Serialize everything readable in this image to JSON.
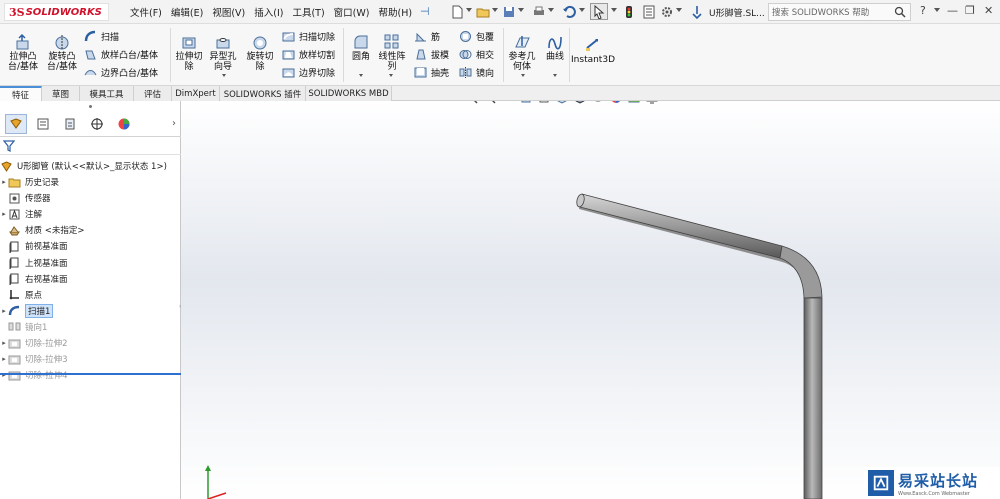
{
  "app": {
    "name": "SOLIDWORKS",
    "brand_color": "#d0112b"
  },
  "menu": [
    "文件(F)",
    "编辑(E)",
    "视图(V)",
    "插入(I)",
    "工具(T)",
    "窗口(W)",
    "帮助(H)"
  ],
  "document_title": "U形脚管.SL...",
  "search": {
    "placeholder": "搜索 SOLIDWORKS 帮助"
  },
  "quick_access_icons": [
    "new-file-icon",
    "open-file-icon",
    "save-icon",
    "print-icon",
    "undo-icon",
    "select-arrow-icon",
    "traffic-light-icon",
    "file-properties-icon",
    "options-gear-icon"
  ],
  "ribbon": {
    "extrude_boss": "拉伸凸台/基体",
    "revolve_boss": "旋转凸台/基体",
    "sweep": "扫描",
    "loft": "放样凸台/基体",
    "boundary_boss": "边界凸台/基体",
    "extrude_cut": "拉伸切除",
    "hole_wizard": "异型孔向导",
    "revolve_cut": "旋转切除",
    "sweep_cut": "扫描切除",
    "loft_cut": "放样切割",
    "boundary_cut": "边界切除",
    "fillet": "圆角",
    "linear_pattern": "线性阵列",
    "rib": "筋",
    "draft": "拔模",
    "shell": "抽壳",
    "wrap": "包覆",
    "intersect": "相交",
    "mirror": "镜向",
    "ref_geometry": "参考几何体",
    "curves": "曲线",
    "instant3d": "Instant3D"
  },
  "tabs": [
    "特征",
    "草图",
    "模具工具",
    "评估",
    "DimXpert",
    "SOLIDWORKS 插件",
    "SOLIDWORKS MBD"
  ],
  "active_tab": "特征",
  "tree": {
    "root": "U形脚管 (默认<<默认>_显示状态 1>)",
    "items": [
      {
        "label": "历史记录",
        "icon": "history-folder-icon",
        "expandable": true,
        "state": "normal"
      },
      {
        "label": "传感器",
        "icon": "sensor-icon",
        "expandable": false,
        "state": "normal"
      },
      {
        "label": "注解",
        "icon": "annotation-icon",
        "expandable": true,
        "state": "normal"
      },
      {
        "label": "材质 <未指定>",
        "icon": "material-icon",
        "expandable": false,
        "state": "normal"
      },
      {
        "label": "前视基准面",
        "icon": "plane-icon",
        "expandable": false,
        "state": "normal"
      },
      {
        "label": "上视基准面",
        "icon": "plane-icon",
        "expandable": false,
        "state": "normal"
      },
      {
        "label": "右视基准面",
        "icon": "plane-icon",
        "expandable": false,
        "state": "normal"
      },
      {
        "label": "原点",
        "icon": "origin-icon",
        "expandable": false,
        "state": "normal"
      },
      {
        "label": "扫描1",
        "icon": "sweep-feature-icon",
        "expandable": true,
        "state": "selected"
      },
      {
        "label": "镜向1",
        "icon": "mirror-feature-icon",
        "expandable": false,
        "state": "suppressed"
      },
      {
        "label": "切除-拉伸2",
        "icon": "cut-extrude-icon",
        "expandable": true,
        "state": "suppressed"
      },
      {
        "label": "切除-拉伸3",
        "icon": "cut-extrude-icon",
        "expandable": true,
        "state": "suppressed"
      },
      {
        "label": "切除-拉伸4",
        "icon": "cut-extrude-icon",
        "expandable": true,
        "state": "suppressed"
      }
    ]
  },
  "watermark": {
    "title": "易采站长站",
    "subtitle": "Www.Easck.Com Webmaster"
  },
  "colors": {
    "accent": "#4a90d9",
    "selection": "#cfe3fb",
    "tube": "#8c8c8c"
  }
}
